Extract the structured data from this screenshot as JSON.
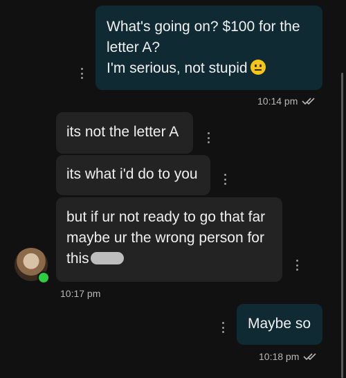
{
  "messages": {
    "m1": {
      "line1": "What's going on? $100 for the",
      "line2": "letter A?",
      "line3": "I'm serious, not stupid",
      "emoji": "neutral-face-emoji",
      "time": "10:14 pm"
    },
    "m2": {
      "text": "its not the letter A"
    },
    "m3": {
      "text": "its what i'd do to you"
    },
    "m4": {
      "line1": "but if ur not ready to go that far",
      "line2": "maybe ur the wrong person for",
      "line3": "this",
      "time": "10:17 pm"
    },
    "m5": {
      "text": "Maybe so",
      "time": "10:18 pm"
    }
  },
  "colors": {
    "outgoing_bubble": "#102a33",
    "incoming_bubble": "#232323",
    "background": "#111111",
    "online": "#2ecc40"
  }
}
